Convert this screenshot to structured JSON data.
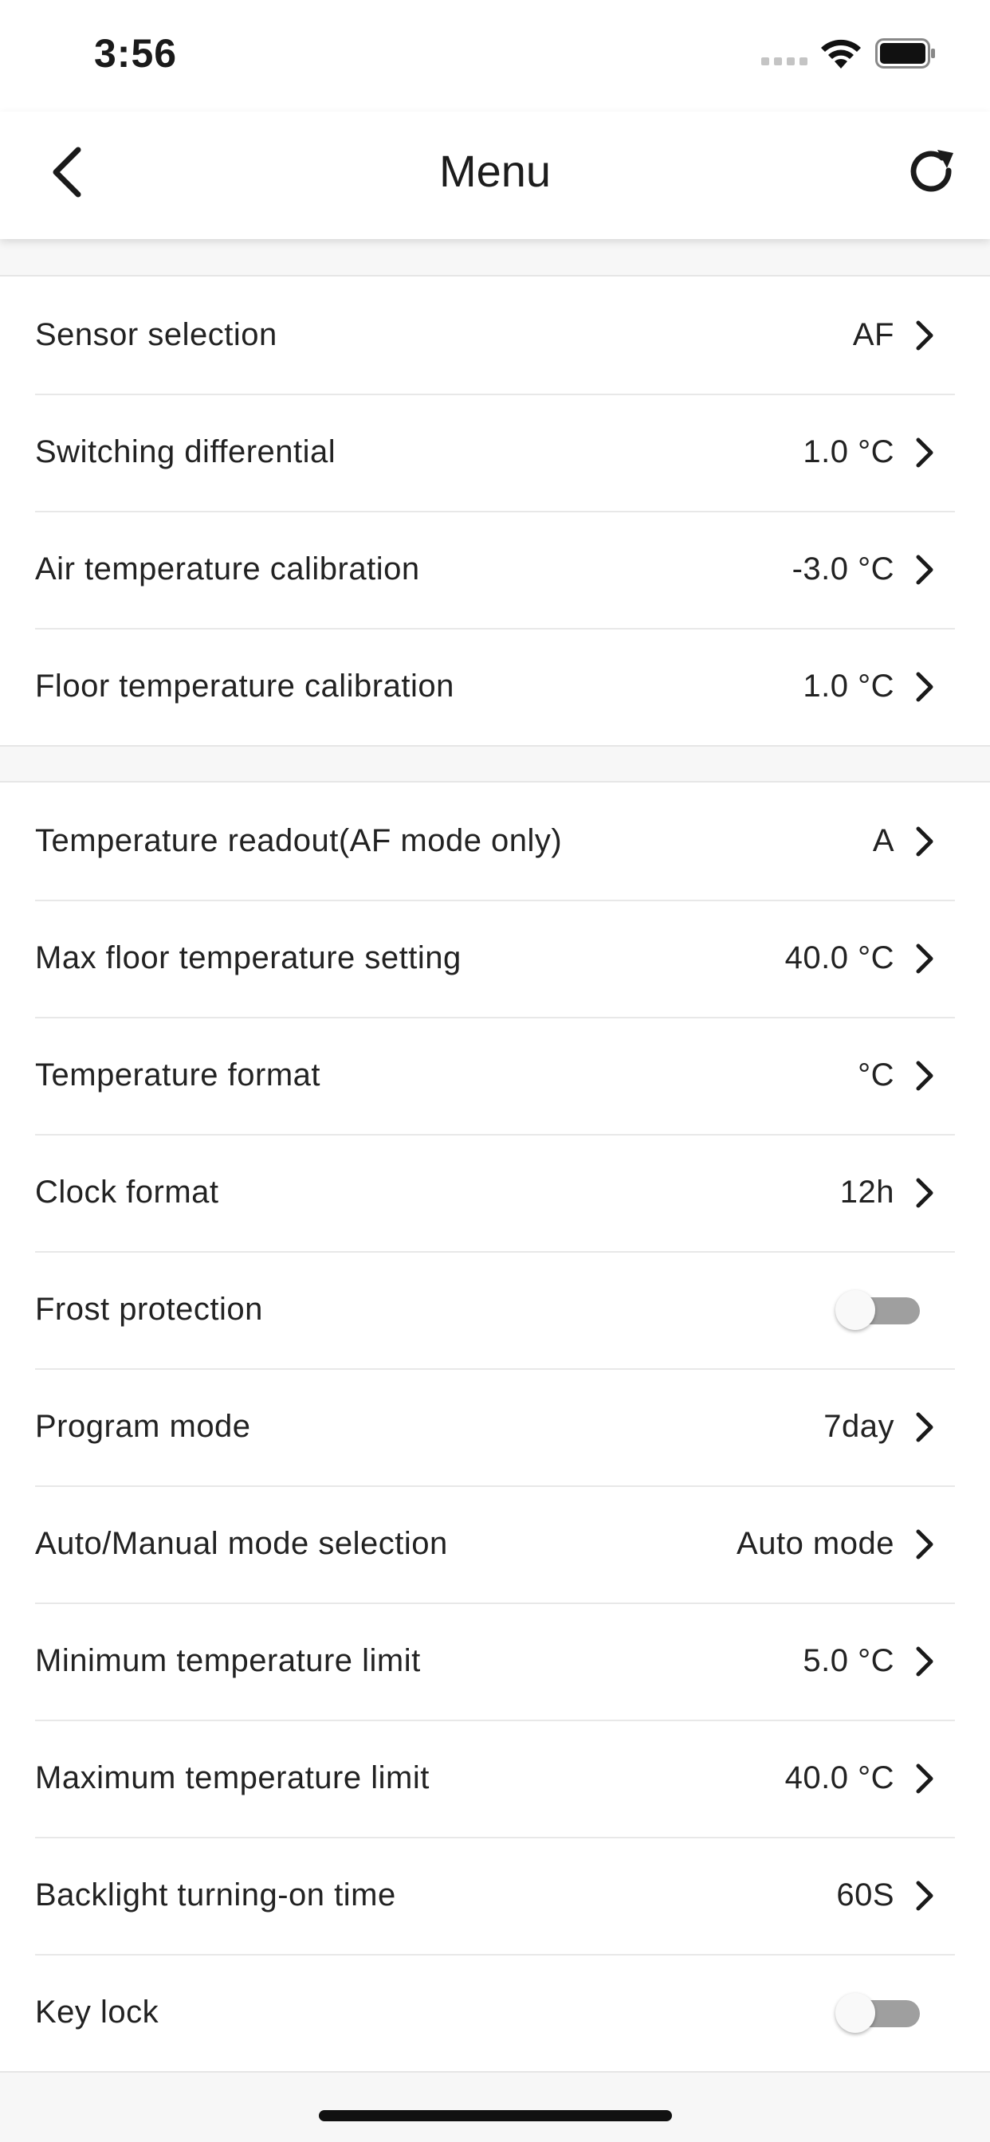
{
  "status_bar": {
    "time": "3:56"
  },
  "nav": {
    "title": "Menu"
  },
  "groups": [
    {
      "rows": [
        {
          "label": "Sensor selection",
          "value": "AF",
          "type": "chevron"
        },
        {
          "label": "Switching differential",
          "value": "1.0 °C",
          "type": "chevron"
        },
        {
          "label": "Air temperature calibration",
          "value": "-3.0 °C",
          "type": "chevron"
        },
        {
          "label": "Floor temperature calibration",
          "value": "1.0 °C",
          "type": "chevron"
        }
      ]
    },
    {
      "rows": [
        {
          "label": "Temperature readout(AF mode only)",
          "value": "A",
          "type": "chevron"
        },
        {
          "label": "Max floor temperature setting",
          "value": "40.0 °C",
          "type": "chevron"
        },
        {
          "label": "Temperature format",
          "value": "°C",
          "type": "chevron"
        },
        {
          "label": "Clock format",
          "value": "12h",
          "type": "chevron"
        },
        {
          "label": "Frost protection",
          "type": "toggle",
          "on": false
        },
        {
          "label": "Program mode",
          "value": "7day",
          "type": "chevron"
        },
        {
          "label": "Auto/Manual mode selection",
          "value": "Auto mode",
          "type": "chevron"
        },
        {
          "label": "Minimum temperature limit",
          "value": "5.0 °C",
          "type": "chevron"
        },
        {
          "label": "Maximum temperature limit",
          "value": "40.0 °C",
          "type": "chevron"
        },
        {
          "label": "Backlight turning-on time",
          "value": "60S",
          "type": "chevron"
        },
        {
          "label": "Key lock",
          "type": "toggle",
          "on": false
        }
      ]
    }
  ],
  "icons": {
    "back": "chevron-left-icon",
    "refresh": "refresh-icon",
    "row_chevron": "chevron-right-icon"
  },
  "colors": {
    "toggle_off_track": "#9f9f9f",
    "background": "#f7f7f7",
    "surface": "#ffffff"
  }
}
